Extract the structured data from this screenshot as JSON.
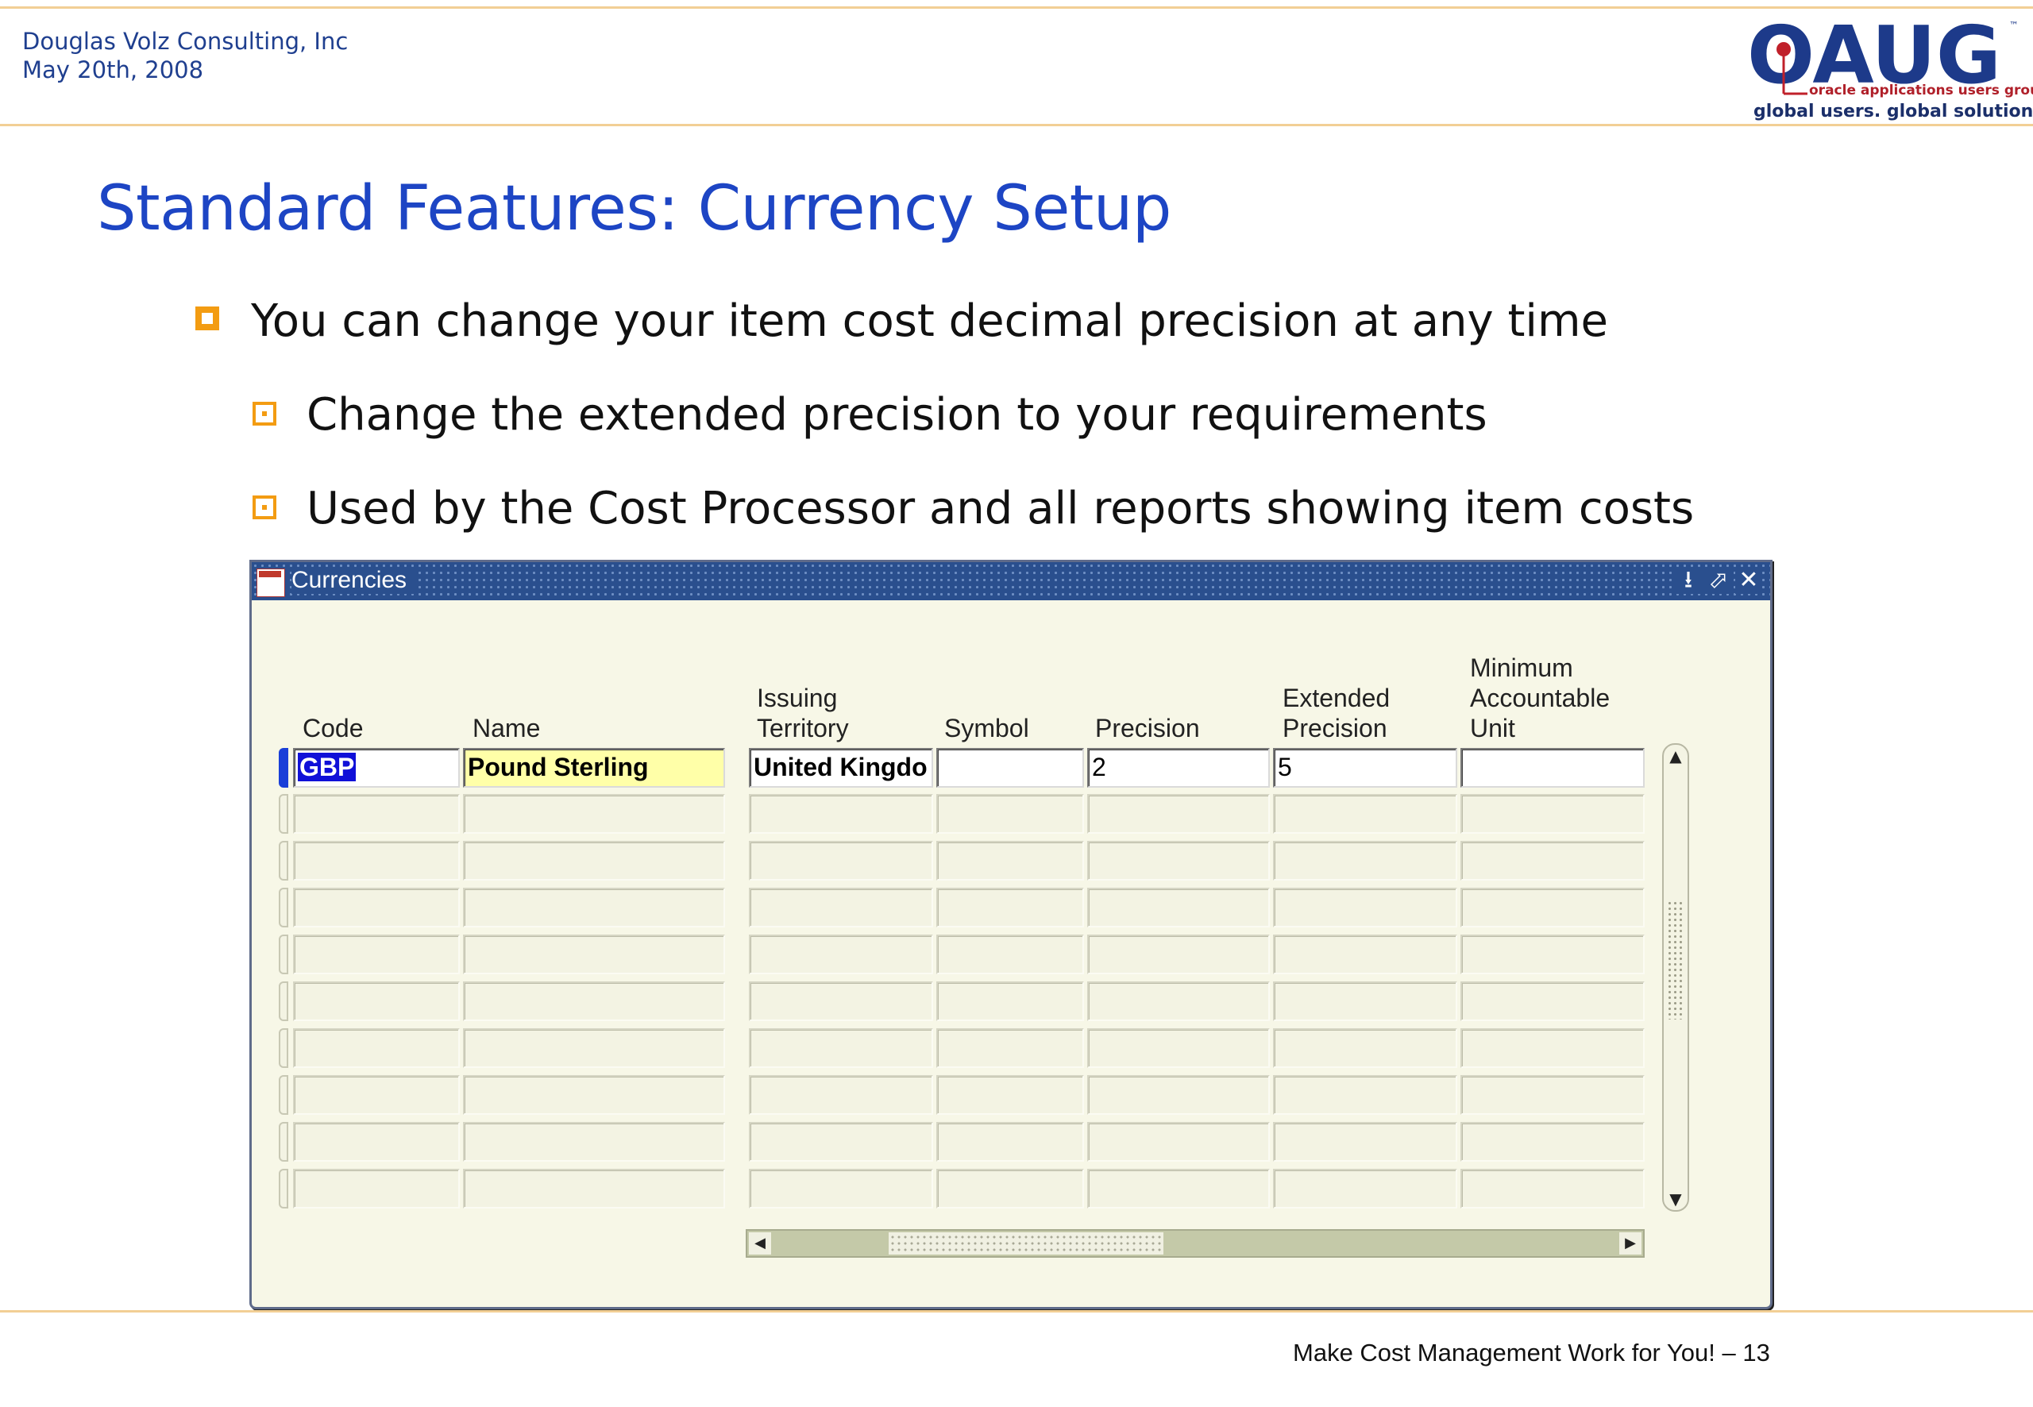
{
  "header": {
    "company": "Douglas Volz Consulting, Inc",
    "date": "May 20th, 2008",
    "logo_text": "OAUG",
    "logo_tm": "™",
    "logo_sub": "oracle applications users group",
    "logo_tagline": "global users. global solutions."
  },
  "slide": {
    "title": "Standard Features:  Currency Setup",
    "bullets": [
      "You can change your item cost decimal precision at any time",
      "Change the extended precision to your requirements",
      "Used by the Cost Processor and all reports showing item costs"
    ]
  },
  "window": {
    "title": "Currencies",
    "controls": {
      "minimize": "⭳",
      "maximize": "⬀",
      "close": "✕"
    },
    "columns": {
      "code": "Code",
      "name": "Name",
      "territory_1": "Issuing",
      "territory_2": "Territory",
      "symbol": "Symbol",
      "precision": "Precision",
      "ext_1": "Extended",
      "ext_2": "Precision",
      "mau_1": "Minimum",
      "mau_2": "Accountable",
      "mau_3": "Unit"
    },
    "row": {
      "code": "GBP",
      "name": "Pound Sterling",
      "territory": "United Kingdo",
      "symbol": "",
      "precision": "2",
      "extended_precision": "5",
      "min_accountable_unit": ""
    },
    "empty_rows": 9
  },
  "footer": {
    "text": "Make Cost Management Work for You! – 13"
  },
  "colors": {
    "title_blue": "#1d45c4",
    "bullet_orange": "#f39c12",
    "titlebar_blue": "#2a4f8e",
    "form_bg": "#f7f7e7",
    "required_field": "#ffffa8"
  }
}
